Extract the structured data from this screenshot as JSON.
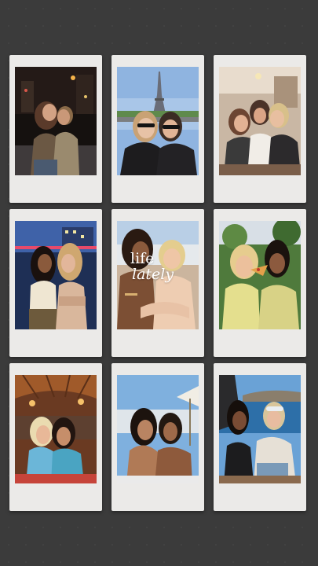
{
  "collage_text": {
    "line1": "life",
    "line2": "lately"
  },
  "photos": [
    {
      "scene": "night-city-hug"
    },
    {
      "scene": "eiffel-tower-selfie"
    },
    {
      "scene": "indoor-group-hug"
    },
    {
      "scene": "night-rooftop-friends"
    },
    {
      "scene": "beach-sunset-hug"
    },
    {
      "scene": "pizza-bite-outdoors"
    },
    {
      "scene": "tiki-bar-friends"
    },
    {
      "scene": "pool-sunshade-friends"
    },
    {
      "scene": "boat-sea-friends"
    }
  ],
  "colors": {
    "background": "#3b3b3b",
    "frame": "#ebeae8"
  }
}
